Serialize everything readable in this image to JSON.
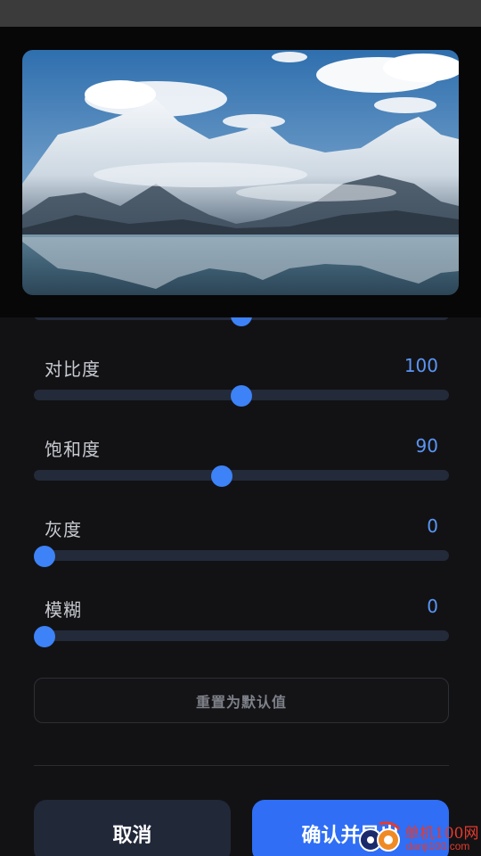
{
  "sliders": [
    {
      "label": "",
      "value": "",
      "level": 0.5
    },
    {
      "label": "对比度",
      "value": "100",
      "level": 0.5
    },
    {
      "label": "饱和度",
      "value": "90",
      "level": 0.45
    },
    {
      "label": "灰度",
      "value": "0",
      "level": 0.0
    },
    {
      "label": "模糊",
      "value": "0",
      "level": 0.0
    }
  ],
  "reset_label": "重置为默认值",
  "cancel_label": "取消",
  "confirm_label": "确认并导出",
  "watermark": {
    "title": "单机100网",
    "url": "danji100.com"
  },
  "colors": {
    "accent": "#3d82f6",
    "value_text": "#5b95f5",
    "track": "#232a3a",
    "cancel_bg": "#212838",
    "confirm_bg": "#2f6ef5",
    "background": "#121214"
  }
}
